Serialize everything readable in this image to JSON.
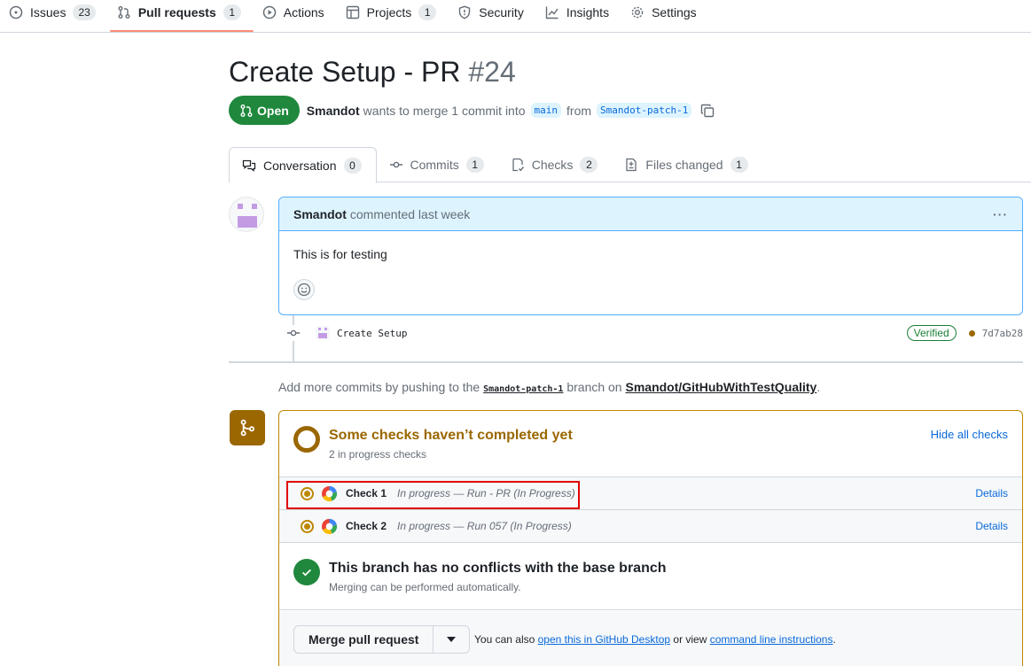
{
  "nav": {
    "issues": {
      "label": "Issues",
      "count": "23"
    },
    "pulls": {
      "label": "Pull requests",
      "count": "1"
    },
    "actions": {
      "label": "Actions"
    },
    "projects": {
      "label": "Projects",
      "count": "1"
    },
    "security": {
      "label": "Security"
    },
    "insights": {
      "label": "Insights"
    },
    "settings": {
      "label": "Settings"
    }
  },
  "pr": {
    "title": "Create Setup - PR",
    "number": "#24",
    "state": "Open",
    "author": "Smandot",
    "merge_text": "wants to merge 1 commit into",
    "base_branch": "main",
    "from_text": "from",
    "head_branch": "Smandot-patch-1"
  },
  "tabs": {
    "conversation": {
      "label": "Conversation",
      "count": "0"
    },
    "commits": {
      "label": "Commits",
      "count": "1"
    },
    "checks": {
      "label": "Checks",
      "count": "2"
    },
    "files": {
      "label": "Files changed",
      "count": "1"
    }
  },
  "comment": {
    "author": "Smandot",
    "meta": "commented last week",
    "menu": "···",
    "body": "This is for testing"
  },
  "commit": {
    "message": "Create Setup",
    "verified": "Verified",
    "sha": "7d7ab28"
  },
  "push_hint": {
    "prefix": "Add more commits by pushing to the",
    "branch": "Smandot-patch-1",
    "middle": "branch on",
    "repo": "Smandot/GitHubWithTestQuality",
    "suffix": "."
  },
  "checks": {
    "title": "Some checks haven’t completed yet",
    "subtitle": "2 in progress checks",
    "hide_label": "Hide all checks",
    "items": [
      {
        "name": "Check 1",
        "description": "In progress — Run - PR (In Progress)",
        "details": "Details"
      },
      {
        "name": "Check 2",
        "description": "In progress — Run 057 (In Progress)",
        "details": "Details"
      }
    ]
  },
  "conflicts": {
    "title": "This branch has no conflicts with the base branch",
    "subtitle": "Merging can be performed automatically."
  },
  "merge": {
    "button": "Merge pull request",
    "hint_prefix": "You can also",
    "desktop_link": "open this in GitHub Desktop",
    "hint_middle": "or view",
    "cli_link": "command line instructions",
    "hint_suffix": "."
  },
  "colors": {
    "accent": "#0969da",
    "open_green": "#1f883d",
    "pending": "#9a6700",
    "highlight": "#e00000"
  }
}
